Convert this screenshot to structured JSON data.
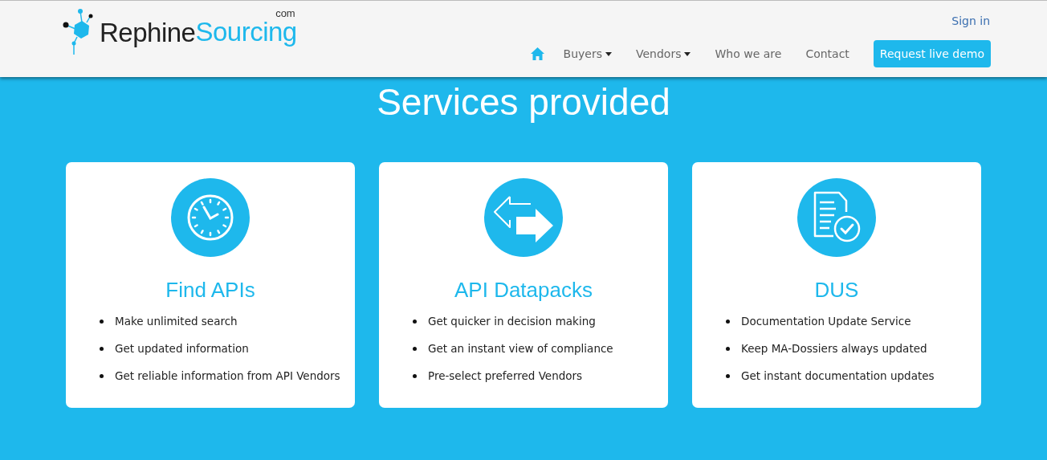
{
  "header": {
    "logo": {
      "part_1": "Rephine",
      "part_2": "Sourcing",
      "part_3": "com"
    },
    "sign_in": "Sign in",
    "nav": [
      {
        "kind": "home"
      },
      {
        "kind": "dropdown",
        "label": "Buyers"
      },
      {
        "kind": "dropdown",
        "label": "Vendors"
      },
      {
        "kind": "link",
        "label": "Who we are"
      },
      {
        "kind": "link",
        "label": "Contact"
      },
      {
        "kind": "button",
        "label": "Request live demo"
      }
    ]
  },
  "section_title": "Services provided",
  "cards": [
    {
      "kind": "clock",
      "title": "Find APIs",
      "items": [
        "Make unlimited search",
        "Get updated information",
        "Get reliable information from API Vendors"
      ]
    },
    {
      "kind": "arrows",
      "title": "API Datapacks",
      "items": [
        "Get quicker in decision making",
        "Get an instant view of compliance",
        "Pre-select preferred Vendors"
      ]
    },
    {
      "kind": "document",
      "title": "DUS",
      "items": [
        "Documentation Update Service",
        "Keep MA-Dossiers always updated",
        "Get instant documentation updates"
      ]
    }
  ]
}
